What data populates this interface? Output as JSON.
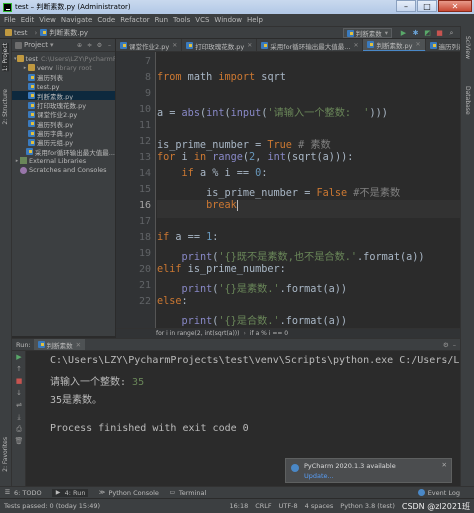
{
  "window": {
    "title": "test – 判断素数.py (Administrator)",
    "min": "–",
    "max": "□",
    "close": "✕"
  },
  "menu": [
    "File",
    "Edit",
    "View",
    "Navigate",
    "Code",
    "Refactor",
    "Run",
    "Tools",
    "VCS",
    "Window",
    "Help"
  ],
  "navbar": {
    "project": "test",
    "file": "判断素数.py",
    "run_config": "判断素数"
  },
  "left_strip": {
    "project": "1: Project",
    "structure": "2: Structure",
    "favorites": "2: Favorites"
  },
  "right_strip": {
    "scm": "SciView",
    "db": "Database"
  },
  "project_panel": {
    "header": "Project",
    "tree": [
      {
        "label": "test",
        "extra": "C:\\Users\\LZY\\PycharmProjects",
        "indent": 0,
        "icon": "folderopen",
        "arrow": "▾"
      },
      {
        "label": "venv",
        "extra": "library root",
        "indent": 1,
        "icon": "folderopen",
        "arrow": "▸"
      },
      {
        "label": "遍历列表",
        "extra": "",
        "indent": 1,
        "icon": "py",
        "arrow": ""
      },
      {
        "label": "test.py",
        "extra": "",
        "indent": 1,
        "icon": "py",
        "arrow": ""
      },
      {
        "label": "判断素数.py",
        "extra": "",
        "indent": 1,
        "icon": "py",
        "arrow": "",
        "selected": true
      },
      {
        "label": "打印玫瑰花数.py",
        "extra": "",
        "indent": 1,
        "icon": "py",
        "arrow": ""
      },
      {
        "label": "课堂作业2.py",
        "extra": "",
        "indent": 1,
        "icon": "py",
        "arrow": ""
      },
      {
        "label": "遍历列表.py",
        "extra": "",
        "indent": 1,
        "icon": "py",
        "arrow": ""
      },
      {
        "label": "遍历字典.py",
        "extra": "",
        "indent": 1,
        "icon": "py",
        "arrow": ""
      },
      {
        "label": "遍历元组.py",
        "extra": "",
        "indent": 1,
        "icon": "py",
        "arrow": ""
      },
      {
        "label": "采用for循环输出最大值最...",
        "extra": "",
        "indent": 1,
        "icon": "py",
        "arrow": ""
      },
      {
        "label": "External Libraries",
        "extra": "",
        "indent": 0,
        "icon": "lib",
        "arrow": "▸"
      },
      {
        "label": "Scratches and Consoles",
        "extra": "",
        "indent": 0,
        "icon": "scratch",
        "arrow": ""
      }
    ]
  },
  "tabs": [
    {
      "label": "课堂作业2.py",
      "active": false
    },
    {
      "label": "打印玫瑰花数.py",
      "active": false
    },
    {
      "label": "采用for循环输出最大值最...",
      "active": false
    },
    {
      "label": "判断素数.py",
      "active": true
    },
    {
      "label": "遍历列表.py",
      "active": false
    }
  ],
  "editor": {
    "line_numbers": [
      "7",
      "8",
      "9",
      "10",
      "11",
      "12",
      "13",
      "14",
      "15",
      "16",
      "17",
      "18",
      "19",
      "20",
      "21",
      "22"
    ],
    "current_line": "16",
    "breadcrumb": [
      "for i in range(2, int(sqrt(a)))",
      "if a % i == 0"
    ]
  },
  "run_panel": {
    "label": "Run:",
    "tab": "判断素数",
    "console": {
      "cmd": "C:\\Users\\LZY\\PycharmProjects\\test\\venv\\Scripts\\python.exe C:/Users/LZ",
      "prompt": "请输入一个整数: ",
      "input": "35",
      "result": "35是素数。",
      "exit": "Process finished with exit code 0"
    }
  },
  "notification": {
    "title": "PyCharm 2020.1.3 available",
    "link": "Update..."
  },
  "bottom_tabs": [
    {
      "label": "6: TODO",
      "icon": "☰",
      "active": false
    },
    {
      "label": "4: Run",
      "icon": "▶",
      "active": true
    },
    {
      "label": "Python Console",
      "icon": "≫",
      "active": false
    },
    {
      "label": "Terminal",
      "icon": "▭",
      "active": false
    }
  ],
  "event_log": "Event Log",
  "status": {
    "left": "Tests passed: 0 (today 15:49)",
    "pos": "16:18",
    "crlf": "CRLF",
    "encoding": "UTF-8",
    "indent": "4 spaces",
    "python": "Python 3.8 (test)",
    "watermark": "CSDN @zl2021班"
  }
}
